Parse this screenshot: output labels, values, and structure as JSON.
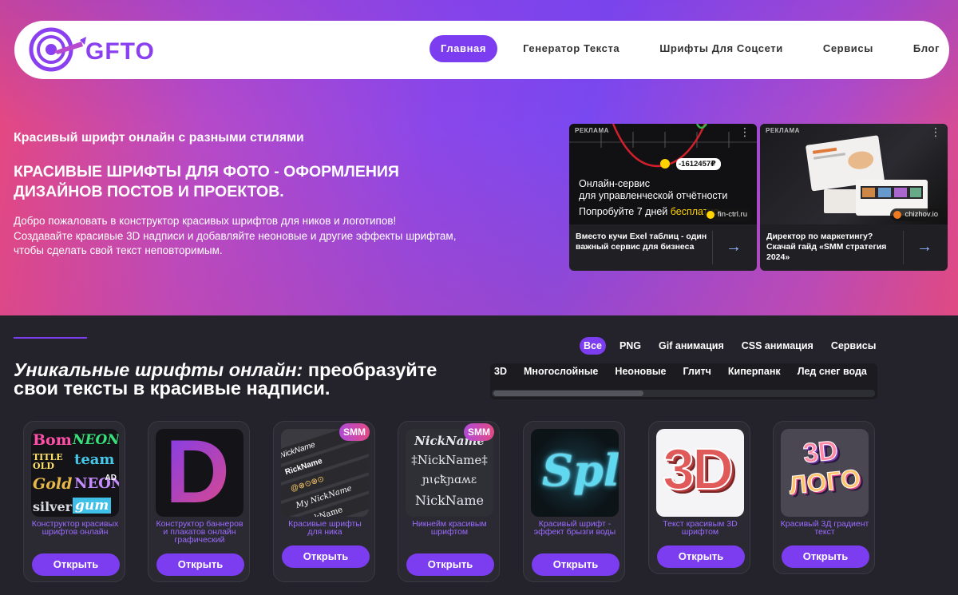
{
  "nav": {
    "logo_text": "GFTO",
    "items": [
      {
        "label": "Главная",
        "active": true
      },
      {
        "label": "Генератор Текста",
        "active": false
      },
      {
        "label": "Шрифты Для Соцсети",
        "active": false
      },
      {
        "label": "Сервисы",
        "active": false
      },
      {
        "label": "Блог",
        "active": false
      }
    ]
  },
  "hero": {
    "subtitle": "Красивый шрифт онлайн с разными стилями",
    "title": "Красивые шрифты для фото - оформления дизайнов постов и проектов.",
    "description_line1": "Добро пожаловать в конструктор красивых шрифтов для ников и логотипов!",
    "description_line2": "Создавайте красивые 3D надписи и добавляйте неоновые и другие эффекты шрифтам, чтобы сделать свой текст неповторимым."
  },
  "ads": [
    {
      "label": "РЕКЛАМА",
      "value_badge": "-1612457₽",
      "line1": "Онлайн-сервис",
      "line2": "для управленческой отчётности",
      "line3_prefix": "Попробуйте 7 дней ",
      "line3_highlight": "бесплатно",
      "domain": "fin-ctrl.ru",
      "caption": "Вместо кучи Exel таблиц - один важный сервис для бизнеса"
    },
    {
      "label": "РЕКЛАМА",
      "domain": "chizhov.io",
      "caption": "Директор по маркетингу? Скачай гайд «SMM стратегия 2024»"
    }
  ],
  "section": {
    "title_italic": "Уникальные шрифты онлайн:",
    "title_rest": " преобразуйте свои тексты в красивые надписи."
  },
  "filters": [
    "Все",
    "PNG",
    "Gif анимация",
    "CSS анимация",
    "Сервисы"
  ],
  "subfilters": [
    "3D",
    "Многослойные",
    "Неоновые",
    "Глитч",
    "Киперпанк",
    "Лед снег вода"
  ],
  "cards": [
    {
      "caption": "Конструктор красивых шрифтов онлайн",
      "button": "Открыть",
      "badge": "",
      "ad_tag": "AD",
      "art": [
        "Bom",
        "NEON",
        "TITLE OLD",
        "team",
        "Gold",
        "NEON",
        "silver",
        "gum"
      ]
    },
    {
      "caption": "Конструктор баннеров и плакатов онлайн графический",
      "button": "Открыть",
      "badge": "",
      "art_letter": "D"
    },
    {
      "caption": "Красивые шрифты для ника",
      "button": "Открыть",
      "badge": "SMM",
      "art": [
        "NickName",
        "RickName",
        "@⊗⊙⊗⊙",
        "My NickName",
        "NickName"
      ]
    },
    {
      "caption": "Никнейм красивым шрифтом",
      "button": "Открыть",
      "badge": "SMM",
      "art": [
        "NickName",
        "‡NickName‡",
        "ɲɩɕꝁɲɑʍɛ",
        "NickName"
      ]
    },
    {
      "caption": "Красивый шрифт - эффект брызги воды",
      "button": "Открыть",
      "badge": "",
      "art_text": "Spl"
    },
    {
      "caption": "Текст красивым 3D шрифтом",
      "button": "Открыть",
      "badge": "",
      "art_text": "3D"
    },
    {
      "caption": "Красивый 3Д градиент текст",
      "button": "Открыть",
      "badge": "",
      "art": [
        "3D",
        "ЛОГО"
      ]
    }
  ]
}
